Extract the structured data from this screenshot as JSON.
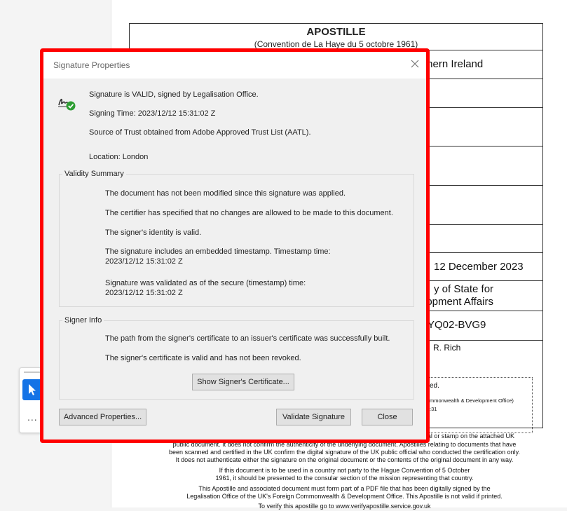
{
  "document": {
    "title": "APOSTILLE",
    "subtitle": "(Convention de La Haye du 5 octobre 1961)",
    "country_fragment": "thern Ireland",
    "date": "12 December 2023",
    "authority_line1": "y of State for",
    "authority_line2": "lopment Affairs",
    "number": "-YQ02-BVG9",
    "signatory": "R. Rich",
    "box_line1": "ed.",
    "box_line2": "mmonwealth & Development Office)",
    "box_line3": ":31",
    "footer": [
      "al or stamp on the attached UK",
      "public document. It does not confirm the authenticity of the underlying document. Apostilles relating to documents that have",
      "been scanned and certified in the UK confirm the digital signature of the UK public official who conducted the certification only.",
      "It does not authenticate either the signature on the original document or the contents of the original document in any way.",
      "If this document is to be used in a country not party to the Hague Convention of 5 October",
      "1961, it should be presented to the consular section of the mission representing that country.",
      "This Apostille and associated document must form part of a PDF file that has been digitally signed by the",
      "Legalisation Office of the UK's Foreign Commonwealth & Development Office. This Apostille is not valid if printed.",
      "To verify this apostille go to www.verifyapostille.service.gov.uk"
    ]
  },
  "dialog": {
    "title": "Signature Properties",
    "status": "Signature is VALID, signed by Legalisation Office.",
    "signing_time": "Signing Time:  2023/12/12 15:31:02 Z",
    "trust_source": "Source of Trust obtained from Adobe Approved Trust List (AATL).",
    "location": "Location:  London",
    "validity_summary": {
      "title": "Validity Summary",
      "items": [
        "The document has not been modified since this signature was applied.",
        "The certifier has specified that no changes are allowed to be made to this document.",
        "The signer's identity is valid.",
        "The signature includes an embedded timestamp. Timestamp time:",
        "2023/12/12 15:31:02 Z",
        "Signature was validated as of the secure (timestamp) time:",
        "2023/12/12 15:31:02 Z"
      ]
    },
    "signer_info": {
      "title": "Signer Info",
      "items": [
        "The path from the signer's certificate to an issuer's certificate was successfully built.",
        "The signer's certificate is valid and has not been revoked."
      ],
      "show_certificate_button": "Show Signer's Certificate..."
    },
    "buttons": {
      "advanced": "Advanced Properties...",
      "validate": "Validate Signature",
      "close": "Close"
    }
  },
  "toolbar": {
    "more": "..."
  },
  "colors": {
    "highlight": "#ff0000",
    "accent": "#1473e6",
    "valid_check": "#2d9d33"
  }
}
